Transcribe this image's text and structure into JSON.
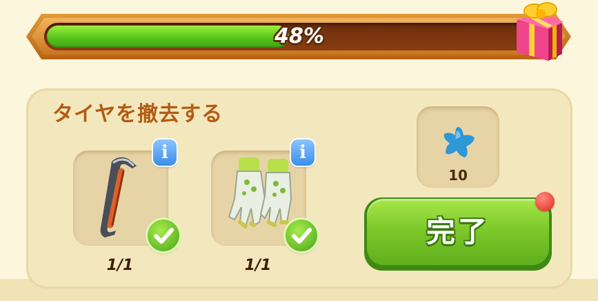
{
  "progress": {
    "value": 0.48,
    "label": "48%"
  },
  "task": {
    "title": "タイヤを撤去する",
    "items": [
      {
        "icon": "crowbar-icon",
        "count": "1/1",
        "completed": true
      },
      {
        "icon": "gloves-icon",
        "count": "1/1",
        "completed": true
      }
    ]
  },
  "reward": {
    "icon": "blue-star-icon",
    "count": "10"
  },
  "complete_button": {
    "label": "完了"
  },
  "colors": {
    "progress_fill": "#56c41c",
    "title": "#b25b12",
    "button": "#7ec92a",
    "notification": "#e3261a"
  }
}
